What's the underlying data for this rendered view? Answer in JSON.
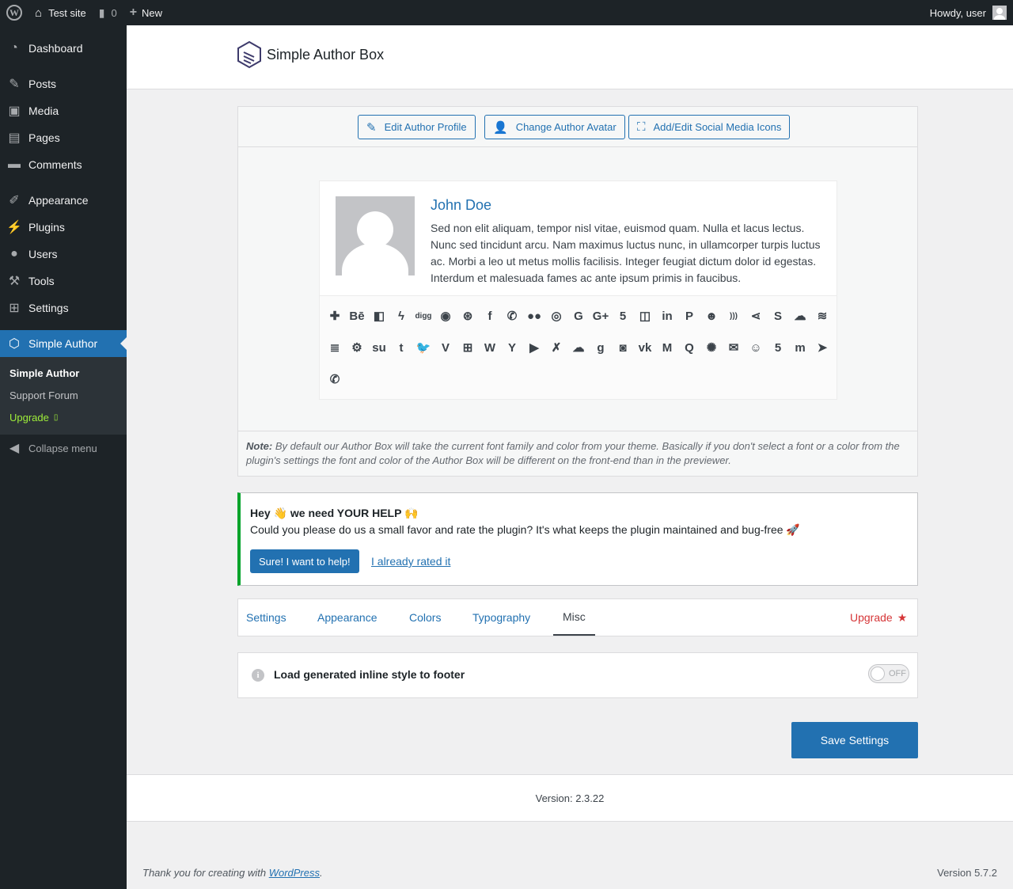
{
  "adminbar": {
    "site_name": "Test site",
    "comments_count": "0",
    "new_label": "New",
    "howdy": "Howdy, user"
  },
  "sidebar": {
    "items": [
      {
        "label": "Dashboard",
        "icon": "dashboard-icon"
      },
      {
        "label": "Posts",
        "icon": "pin-icon"
      },
      {
        "label": "Media",
        "icon": "media-icon"
      },
      {
        "label": "Pages",
        "icon": "pages-icon"
      },
      {
        "label": "Comments",
        "icon": "comments-icon"
      },
      {
        "label": "Appearance",
        "icon": "brush-icon"
      },
      {
        "label": "Plugins",
        "icon": "plug-icon"
      },
      {
        "label": "Users",
        "icon": "user-icon"
      },
      {
        "label": "Tools",
        "icon": "wrench-icon"
      },
      {
        "label": "Settings",
        "icon": "settings-icon"
      },
      {
        "label": "Simple Author",
        "icon": "cube-icon"
      }
    ],
    "submenu": [
      "Simple Author",
      "Support Forum",
      "Upgrade"
    ],
    "collapse": "Collapse menu"
  },
  "plugin": {
    "logo_text": "Simple Author Box",
    "toolbar": {
      "edit_profile": "Edit Author Profile",
      "change_avatar": "Change Author Avatar",
      "social_icons": "Add/Edit Social Media Icons"
    },
    "preview": {
      "author_name": "John Doe",
      "bio": "Sed non elit aliquam, tempor nisl vitae, euismod quam. Nulla et lacus lectus. Nunc sed tincidunt arcu. Nam maximus luctus nunc, in ullamcorper turpis luctus ac. Morbi a leo ut metus mollis facilisis. Integer feugiat dictum dolor id egestas. Interdum et malesuada fames ac ante ipsum primis in faucibus."
    },
    "social_icons": [
      {
        "name": "addthis-icon",
        "glyph": "✚"
      },
      {
        "name": "behance-icon",
        "glyph": "Bē"
      },
      {
        "name": "delicious-icon",
        "glyph": "◧"
      },
      {
        "name": "deviantart-icon",
        "glyph": "ϟ"
      },
      {
        "name": "digg-icon",
        "glyph": "digg"
      },
      {
        "name": "discord-icon",
        "glyph": "◉"
      },
      {
        "name": "dribbble-icon",
        "glyph": "⊛"
      },
      {
        "name": "facebook-icon",
        "glyph": "f"
      },
      {
        "name": "whatsapp-icon",
        "glyph": "✆"
      },
      {
        "name": "flickr-icon",
        "glyph": "●●"
      },
      {
        "name": "github-icon",
        "glyph": "◎"
      },
      {
        "name": "google-icon",
        "glyph": "G"
      },
      {
        "name": "googleplus-icon",
        "glyph": "G+"
      },
      {
        "name": "html5-icon",
        "glyph": "5"
      },
      {
        "name": "instagram-icon",
        "glyph": "◫"
      },
      {
        "name": "linkedin-icon",
        "glyph": "in"
      },
      {
        "name": "pinterest-icon",
        "glyph": "P"
      },
      {
        "name": "reddit-icon",
        "glyph": "☻"
      },
      {
        "name": "rss-icon",
        "glyph": ")))"
      },
      {
        "name": "share-icon",
        "glyph": "⋖"
      },
      {
        "name": "skype-icon",
        "glyph": "S"
      },
      {
        "name": "soundcloud-icon",
        "glyph": "☁"
      },
      {
        "name": "spotify-icon",
        "glyph": "≋"
      },
      {
        "name": "stackoverflow-icon",
        "glyph": "≣"
      },
      {
        "name": "steam-icon",
        "glyph": "⚙"
      },
      {
        "name": "stumbleupon-icon",
        "glyph": "su"
      },
      {
        "name": "tumblr-icon",
        "glyph": "t"
      },
      {
        "name": "twitter-icon",
        "glyph": "🐦"
      },
      {
        "name": "vimeo-icon",
        "glyph": "V"
      },
      {
        "name": "windows-icon",
        "glyph": "⊞"
      },
      {
        "name": "wordpress-icon",
        "glyph": "W"
      },
      {
        "name": "yahoo-icon",
        "glyph": "Y"
      },
      {
        "name": "youtube-icon",
        "glyph": "▶"
      },
      {
        "name": "xing-icon",
        "glyph": "✗"
      },
      {
        "name": "mixcloud-icon",
        "glyph": "☁"
      },
      {
        "name": "goodreads-icon",
        "glyph": "g"
      },
      {
        "name": "twitch-icon",
        "glyph": "◙"
      },
      {
        "name": "vk-icon",
        "glyph": "vk"
      },
      {
        "name": "medium-icon",
        "glyph": "M"
      },
      {
        "name": "quora-icon",
        "glyph": "Q"
      },
      {
        "name": "meetup-icon",
        "glyph": "✺"
      },
      {
        "name": "email-icon",
        "glyph": "✉"
      },
      {
        "name": "snapchat-icon",
        "glyph": "☺"
      },
      {
        "name": "500px-icon",
        "glyph": "5"
      },
      {
        "name": "mastodon-icon",
        "glyph": "m"
      },
      {
        "name": "telegram-icon",
        "glyph": "➤"
      },
      {
        "name": "phone-icon",
        "glyph": "✆"
      }
    ],
    "note_label": "Note:",
    "note_text": "By default our Author Box will take the current font family and color from your theme. Basically if you don't select a font or a color from the plugin's settings the font and color of the Author Box will be different on the front-end than in the previewer.",
    "notice": {
      "title": "Hey 👋 we need YOUR HELP 🙌",
      "body": "Could you please do us a small favor and rate the plugin? It's what keeps the plugin maintained and bug-free 🚀",
      "primary": "Sure! I want to help!",
      "secondary": "I already rated it"
    },
    "tabs": [
      "Settings",
      "Appearance",
      "Colors",
      "Typography",
      "Misc"
    ],
    "upgrade_tab": "Upgrade",
    "setting_label": "Load generated inline style to footer",
    "toggle_state": "OFF",
    "save": "Save Settings",
    "version": "Version: 2.3.22"
  },
  "footer": {
    "thank_you": "Thank you for creating with",
    "wp_link": "WordPress",
    "period": ".",
    "wp_version": "Version 5.7.2"
  },
  "colors": {
    "primary": "#2271b1",
    "sidebar": "#1d2327",
    "notice_border": "#00a32a",
    "upgrade": "#d63638"
  }
}
